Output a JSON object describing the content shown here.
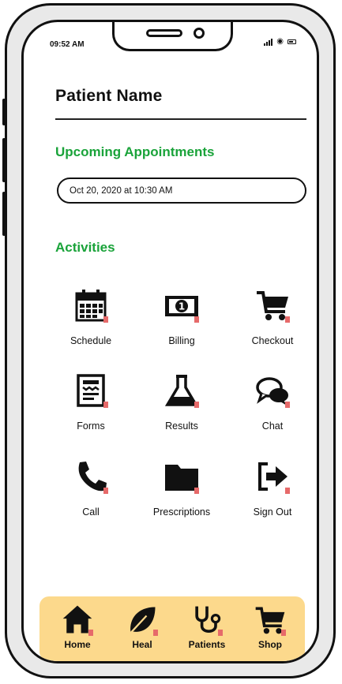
{
  "status_bar": {
    "time": "09:52 AM"
  },
  "patient": {
    "name": "Patient Name"
  },
  "appointments": {
    "title": "Upcoming Appointments",
    "items": [
      "Oct 20, 2020 at 10:30 AM"
    ]
  },
  "activities": {
    "title": "Activities",
    "items": [
      {
        "label": "Schedule",
        "icon": "calendar-icon"
      },
      {
        "label": "Billing",
        "icon": "money-icon"
      },
      {
        "label": "Checkout",
        "icon": "cart-icon"
      },
      {
        "label": "Forms",
        "icon": "form-icon"
      },
      {
        "label": "Results",
        "icon": "flask-icon"
      },
      {
        "label": "Chat",
        "icon": "chat-icon"
      },
      {
        "label": "Call",
        "icon": "phone-icon"
      },
      {
        "label": "Prescriptions",
        "icon": "folder-icon"
      },
      {
        "label": "Sign Out",
        "icon": "sign-out-icon"
      }
    ]
  },
  "tabbar": {
    "items": [
      {
        "label": "Home",
        "icon": "home-icon"
      },
      {
        "label": "Heal",
        "icon": "leaf-icon"
      },
      {
        "label": "Patients",
        "icon": "stethoscope-icon"
      },
      {
        "label": "Shop",
        "icon": "cart-icon"
      }
    ]
  },
  "colors": {
    "accent": "#1aa33a",
    "tabbar_bg": "#fcd98c",
    "marker": "#e66a6a"
  }
}
